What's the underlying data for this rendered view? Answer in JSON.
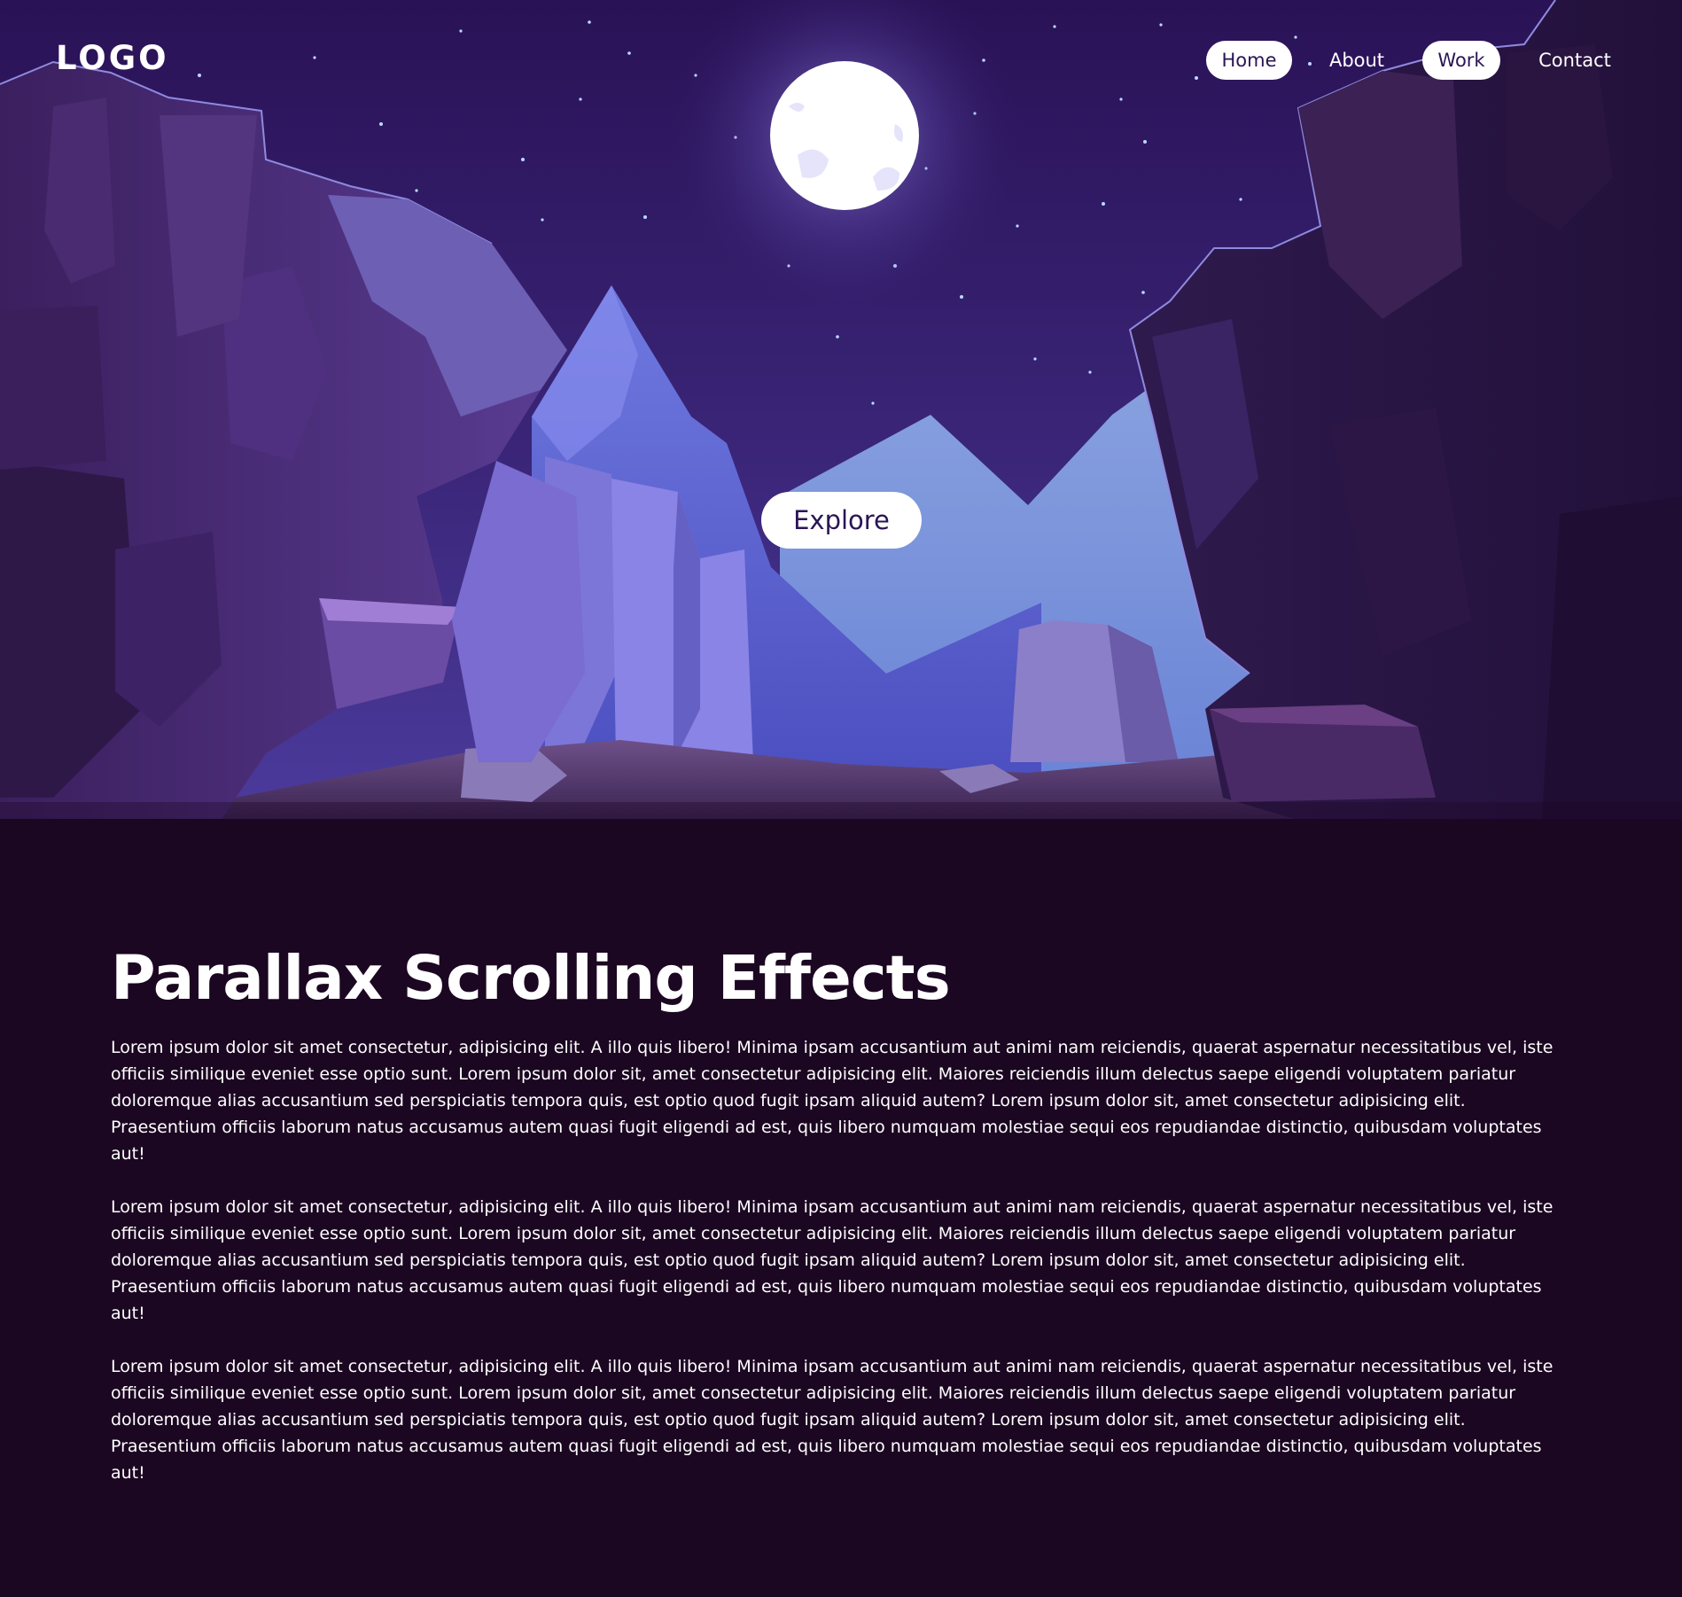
{
  "header": {
    "logo": "LOGO",
    "nav": [
      "Home",
      "About",
      "Work",
      "Contact"
    ]
  },
  "hero": {
    "cta_label": "Explore"
  },
  "main": {
    "title": "Parallax Scrolling Effects",
    "paragraphs": [
      "Lorem ipsum dolor sit amet consectetur, adipisicing elit. A illo quis libero! Minima ipsam accusantium aut animi nam reiciendis, quaerat aspernatur necessitatibus vel, iste officiis similique eveniet esse optio sunt. Lorem ipsum dolor sit, amet consectetur adipisicing elit. Maiores reiciendis illum delectus saepe eligendi voluptatem pariatur doloremque alias accusantium sed perspiciatis tempora quis, est optio quod fugit ipsam aliquid autem? Lorem ipsum dolor sit, amet consectetur adipisicing elit. Praesentium officiis laborum natus accusamus autem quasi fugit eligendi ad est, quis libero numquam molestiae sequi eos repudiandae distinctio, quibusdam voluptates aut!",
      "Lorem ipsum dolor sit amet consectetur, adipisicing elit. A illo quis libero! Minima ipsam accusantium aut animi nam reiciendis, quaerat aspernatur necessitatibus vel, iste officiis similique eveniet esse optio sunt. Lorem ipsum dolor sit, amet consectetur adipisicing elit. Maiores reiciendis illum delectus saepe eligendi voluptatem pariatur doloremque alias accusantium sed perspiciatis tempora quis, est optio quod fugit ipsam aliquid autem? Lorem ipsum dolor sit, amet consectetur adipisicing elit. Praesentium officiis laborum natus accusamus autem quasi fugit eligendi ad est, quis libero numquam molestiae sequi eos repudiandae distinctio, quibusdam voluptates aut!",
      "Lorem ipsum dolor sit amet consectetur, adipisicing elit. A illo quis libero! Minima ipsam accusantium aut animi nam reiciendis, quaerat aspernatur necessitatibus vel, iste officiis similique eveniet esse optio sunt. Lorem ipsum dolor sit, amet consectetur adipisicing elit. Maiores reiciendis illum delectus saepe eligendi voluptatem pariatur doloremque alias accusantium sed perspiciatis tempora quis, est optio quod fugit ipsam aliquid autem? Lorem ipsum dolor sit, amet consectetur adipisicing elit. Praesentium officiis laborum natus accusamus autem quasi fugit eligendi ad est, quis libero numquam molestiae sequi eos repudiandae distinctio, quibusdam voluptates aut!"
    ]
  },
  "colors": {
    "sky_top": "#2a1256",
    "sky_bottom": "#3d2a85",
    "moon": "#ffffff",
    "page_background": "#1c0722",
    "pill_text": "#2a1555"
  }
}
